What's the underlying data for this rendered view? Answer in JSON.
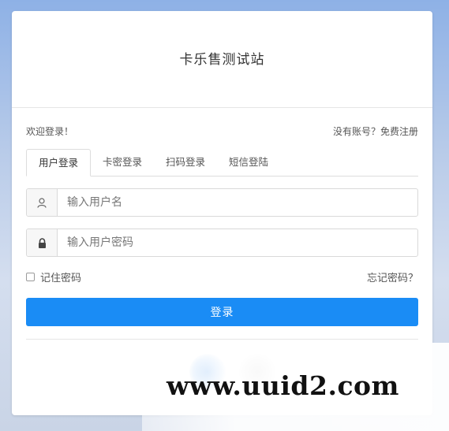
{
  "site": {
    "title": "卡乐售测试站"
  },
  "welcome": {
    "text": "欢迎登录！",
    "register_link": "没有账号？免费注册"
  },
  "tabs": [
    {
      "label": "用户登录",
      "active": true
    },
    {
      "label": "卡密登录",
      "active": false
    },
    {
      "label": "扫码登录",
      "active": false
    },
    {
      "label": "短信登陆",
      "active": false
    }
  ],
  "form": {
    "username": {
      "placeholder": "输入用户名",
      "value": "",
      "icon": "user-icon"
    },
    "password": {
      "placeholder": "输入用户密码",
      "value": "",
      "icon": "lock-icon"
    },
    "remember_label": "记住密码",
    "remember_checked": false,
    "forgot_label": "忘记密码？",
    "submit_label": "登录"
  },
  "colors": {
    "primary": "#1a8cf5"
  },
  "watermark": {
    "text": "www.uuid2.com"
  }
}
